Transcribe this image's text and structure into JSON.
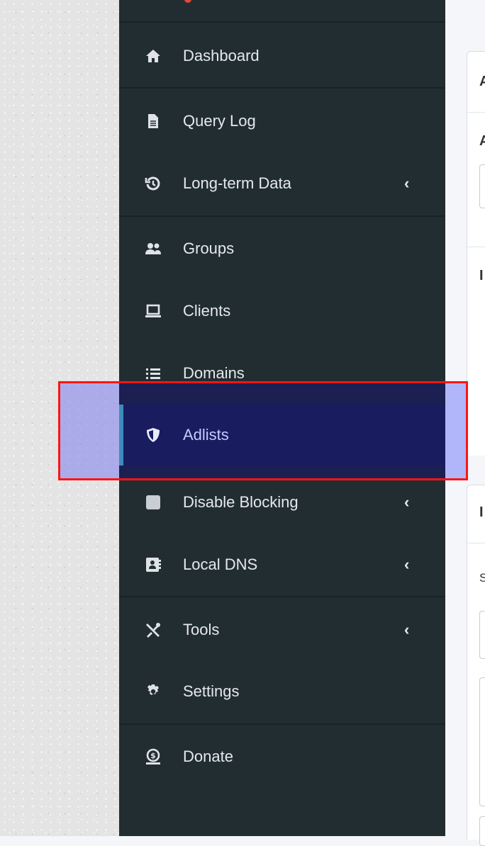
{
  "sidebar": {
    "items": [
      {
        "label": "Dashboard",
        "icon": "home-icon",
        "chevron": ""
      },
      {
        "label": "Query Log",
        "icon": "file-icon",
        "chevron": ""
      },
      {
        "label": "Long-term Data",
        "icon": "history-icon",
        "chevron": "‹"
      },
      {
        "label": "Groups",
        "icon": "users-icon",
        "chevron": ""
      },
      {
        "label": "Clients",
        "icon": "laptop-icon",
        "chevron": ""
      },
      {
        "label": "Domains",
        "icon": "list-icon",
        "chevron": ""
      },
      {
        "label": "Adlists",
        "icon": "shield-icon",
        "chevron": ""
      },
      {
        "label": "Disable Blocking",
        "icon": "stop-icon",
        "chevron": "‹"
      },
      {
        "label": "Local DNS",
        "icon": "address-book-icon",
        "chevron": "‹"
      },
      {
        "label": "Tools",
        "icon": "tools-icon",
        "chevron": "‹"
      },
      {
        "label": "Settings",
        "icon": "gear-icon",
        "chevron": ""
      },
      {
        "label": "Donate",
        "icon": "donate-icon",
        "chevron": ""
      }
    ],
    "active_item": "Adlists"
  },
  "content": {
    "letters": [
      "A",
      "A",
      "I",
      "I",
      "S"
    ]
  },
  "colors": {
    "sidebar_bg": "#222d32",
    "active_bg": "#1a1c60",
    "active_bar": "#3c8dbc",
    "highlight_border": "#ff1414"
  }
}
